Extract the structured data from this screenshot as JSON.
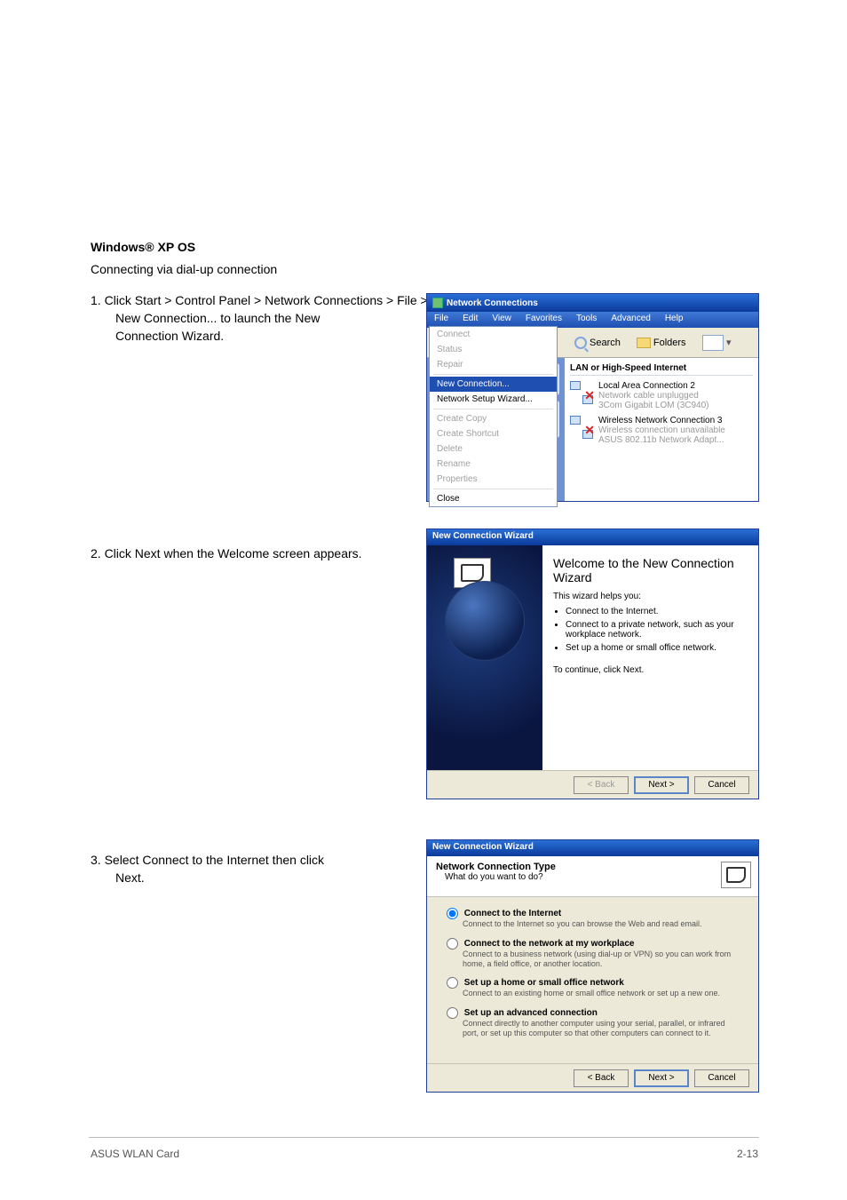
{
  "pageText": {
    "heading": "Windows® XP OS",
    "sub1": "Connecting via dial-up connection",
    "step1": "1. Click Start > Control Panel > Network Connections > File >",
    "step1b": "New Connection... to launch the New",
    "step1c": "Connection Wizard.",
    "step2": "2. Click Next when the Welcome screen appears.",
    "step3": "3. Select Connect to the Internet then click",
    "step3b": "Next.",
    "footerLeft": "ASUS WLAN Card",
    "footerRight": "2-13"
  },
  "nc": {
    "title": "Network Connections",
    "menu": {
      "file": "File",
      "edit": "Edit",
      "view": "View",
      "favorites": "Favorites",
      "tools": "Tools",
      "advanced": "Advanced",
      "help": "Help"
    },
    "toolbar": {
      "search": "Search",
      "folders": "Folders"
    },
    "filemenu": {
      "connect": "Connect",
      "status": "Status",
      "repair": "Repair",
      "newconn": "New Connection...",
      "nsw": "Network Setup Wizard...",
      "copy": "Create Copy",
      "shortcut": "Create Shortcut",
      "delete": "Delete",
      "rename": "Rename",
      "properties": "Properties",
      "close": "Close"
    },
    "groupHeader": "LAN or High-Speed Internet",
    "conn1": {
      "name": "Local Area Connection 2",
      "status": "Network cable unplugged",
      "device": "3Com Gigabit LOM (3C940)"
    },
    "conn2": {
      "name": "Wireless Network Connection 3",
      "status": "Wireless connection unavailable",
      "device": "ASUS 802.11b Network Adapt..."
    }
  },
  "wz1": {
    "title": "New Connection Wizard",
    "heading": "Welcome to the New Connection Wizard",
    "lead": "This wizard helps you:",
    "b1": "Connect to the Internet.",
    "b2": "Connect to a private network, such as your workplace network.",
    "b3": "Set up a home or small office network.",
    "cont": "To continue, click Next.",
    "back": "< Back",
    "next": "Next >",
    "cancel": "Cancel"
  },
  "wz2": {
    "title": "New Connection Wizard",
    "head": "Network Connection Type",
    "sub": "What do you want to do?",
    "o1": {
      "label": "Connect to the Internet",
      "desc": "Connect to the Internet so you can browse the Web and read email."
    },
    "o2": {
      "label": "Connect to the network at my workplace",
      "desc": "Connect to a business network (using dial-up or VPN) so you can work from home, a field office, or another location."
    },
    "o3": {
      "label": "Set up a home or small office network",
      "desc": "Connect to an existing home or small office network or set up a new one."
    },
    "o4": {
      "label": "Set up an advanced connection",
      "desc": "Connect directly to another computer using your serial, parallel, or infrared port, or set up this computer so that other computers can connect to it."
    },
    "back": "< Back",
    "next": "Next >",
    "cancel": "Cancel"
  }
}
